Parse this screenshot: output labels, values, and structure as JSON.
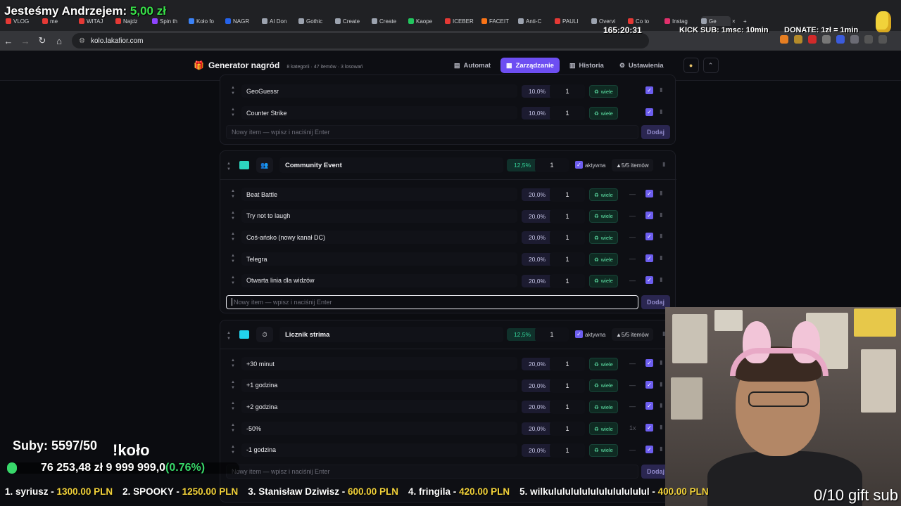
{
  "browser": {
    "tabs": [
      {
        "label": "VLOG",
        "color": "#e53935"
      },
      {
        "label": "me",
        "color": "#e53935"
      },
      {
        "label": "WITAJ",
        "color": "#e53935"
      },
      {
        "label": "Najdz",
        "color": "#e53935"
      },
      {
        "label": "Spin th",
        "color": "#8e44ff"
      },
      {
        "label": "Koło fo",
        "color": "#3b82f6"
      },
      {
        "label": "NAGR",
        "color": "#2563eb"
      },
      {
        "label": "AI Don",
        "color": "#9ca3af"
      },
      {
        "label": "Gothic",
        "color": "#9ca3af"
      },
      {
        "label": "Create",
        "color": "#9ca3af"
      },
      {
        "label": "Create",
        "color": "#9ca3af"
      },
      {
        "label": "Kaope",
        "color": "#22c55e"
      },
      {
        "label": "ICEBER",
        "color": "#e53935"
      },
      {
        "label": "FACEIT",
        "color": "#f97316"
      },
      {
        "label": "Anti-C",
        "color": "#9ca3af"
      },
      {
        "label": "PAULI",
        "color": "#e53935"
      },
      {
        "label": "Overvi",
        "color": "#9ca3af"
      },
      {
        "label": "Co to",
        "color": "#e53935"
      },
      {
        "label": "Instag",
        "color": "#e1306c"
      },
      {
        "label": "Ge",
        "color": "#9ca3af"
      }
    ],
    "active_tab_index": 19,
    "url": "kolo.lakafior.com"
  },
  "overlay": {
    "top_title": "Jesteśmy Andrzejem:",
    "top_amount": "5,00 zł",
    "timer": "165:20:31",
    "kick_sub": "KICK SUB: 1msc: 10min",
    "donate": "DONATE: 1zł = 1min",
    "subs": "Suby: 5597/50",
    "kolo": "!koło",
    "progress_text_main": "76 253,48 zł  9 999 999,0",
    "progress_text_pct": "(0.76%)",
    "progress_fraction": 0.0076,
    "gift_sub": "0/10 gift sub",
    "ticker": [
      {
        "who": "1. syriusz - ",
        "amt": "1300.00 PLN"
      },
      {
        "who": "2. SPOOKY - ",
        "amt": "1250.00 PLN"
      },
      {
        "who": "3. Stanisław Dziwisz - ",
        "amt": "600.00 PLN"
      },
      {
        "who": "4. fringila - ",
        "amt": "420.00 PLN"
      },
      {
        "who": "5. wilkulululululululululululul - ",
        "amt": "400.00 PLN"
      }
    ]
  },
  "app": {
    "title": "Generator nagród",
    "subtitle": "8 kategorii · 47 itemów · 3 losowań",
    "nav": [
      {
        "label": "Automat",
        "icon": "▤",
        "active": false
      },
      {
        "label": "Zarządzanie",
        "icon": "▦",
        "active": true
      },
      {
        "label": "Historia",
        "icon": "▥",
        "active": false
      },
      {
        "label": "Ustawienia",
        "icon": "⚙",
        "active": false
      }
    ],
    "labels": {
      "new_item_placeholder": "Nowy item — wpisz i naciśnij Enter",
      "add_button": "Dodaj",
      "active_label": "aktywna",
      "many": "wiele",
      "dash": "—",
      "once": "1x"
    },
    "top_items": [
      {
        "name": "GeoGuessr",
        "pct": "10,0%",
        "weight": "1"
      },
      {
        "name": "Counter Strike",
        "pct": "10,0%",
        "weight": "1"
      }
    ],
    "categories": [
      {
        "name": "Community Event",
        "color": "#2dd4bf",
        "icon": "👥",
        "pct": "12,5%",
        "weight": "1",
        "count": "5/5 itemów",
        "items": [
          {
            "name": "Beat Battle",
            "pct": "20,0%",
            "weight": "1",
            "limit": "—"
          },
          {
            "name": "Try not to laugh",
            "pct": "20,0%",
            "weight": "1",
            "limit": "—"
          },
          {
            "name": "Coś-ańsko (nowy kanał DC)",
            "pct": "20,0%",
            "weight": "1",
            "limit": "—"
          },
          {
            "name": "Telegra",
            "pct": "20,0%",
            "weight": "1",
            "limit": "—"
          },
          {
            "name": "Otwarta linia dla widzów",
            "pct": "20,0%",
            "weight": "1",
            "limit": "—"
          }
        ]
      },
      {
        "name": "Licznik strima",
        "color": "#22d3ee",
        "icon": "⏱",
        "pct": "12,5%",
        "weight": "1",
        "count": "5/5 itemów",
        "items": [
          {
            "name": "+30 minut",
            "pct": "20,0%",
            "weight": "1",
            "limit": "—"
          },
          {
            "name": "+1 godzina",
            "pct": "20,0%",
            "weight": "1",
            "limit": "—"
          },
          {
            "name": "+2 godzina",
            "pct": "20,0%",
            "weight": "1",
            "limit": "—"
          },
          {
            "name": "-50%",
            "pct": "20,0%",
            "weight": "1",
            "limit": "1x"
          },
          {
            "name": "-1 godzina",
            "pct": "20,0%",
            "weight": "1",
            "limit": "—"
          }
        ]
      }
    ]
  }
}
